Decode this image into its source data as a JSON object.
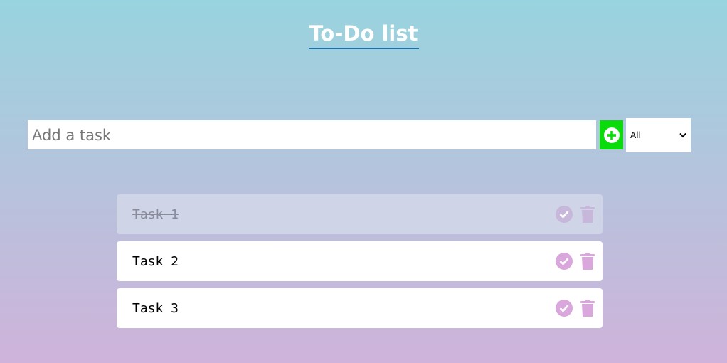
{
  "header": {
    "title": "To-Do list"
  },
  "input": {
    "placeholder": "Add a task",
    "value": ""
  },
  "add_button": {
    "icon": "plus-circle-icon",
    "color": "#0adb0a"
  },
  "filter": {
    "selected": "All"
  },
  "tasks": [
    {
      "label": "Task 1",
      "completed": true
    },
    {
      "label": "Task 2",
      "completed": false
    },
    {
      "label": "Task 3",
      "completed": false
    }
  ],
  "colors": {
    "accent_icon": "#d9a7dc",
    "title_underline": "#1f6fa8"
  }
}
